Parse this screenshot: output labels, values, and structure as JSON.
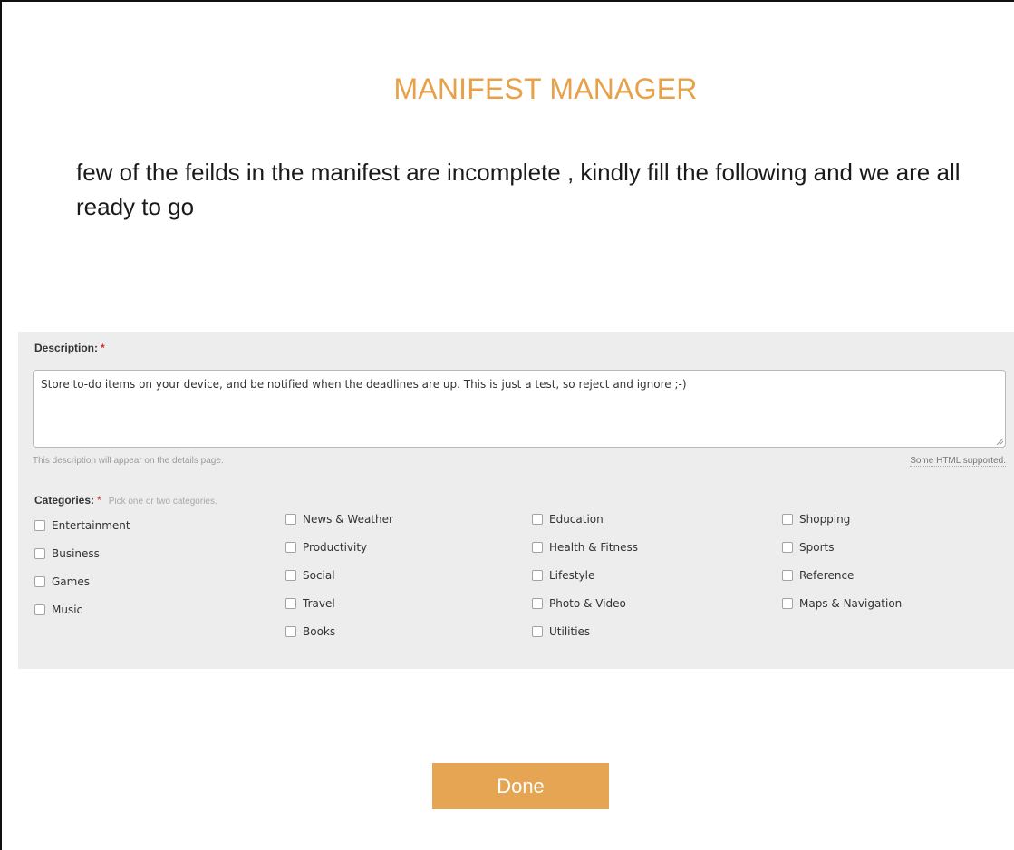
{
  "header": {
    "title": "MANIFEST MANAGER"
  },
  "intro": {
    "text": "few of the feilds in the manifest are incomplete , kindly fill the following and we are all ready to go"
  },
  "description": {
    "label": "Description:",
    "required_mark": "*",
    "value": "Store to-do items on your device, and be notified when the deadlines are up. This is just a test, so reject and ignore ;-)",
    "help_text": "This description will appear on the details page.",
    "html_note": "Some HTML supported."
  },
  "categories": {
    "label": "Categories:",
    "required_mark": "*",
    "hint": "Pick one or two categories.",
    "columns": [
      [
        "Entertainment",
        "Business",
        "Games",
        "Music"
      ],
      [
        "News & Weather",
        "Productivity",
        "Social",
        "Travel",
        "Books"
      ],
      [
        "Education",
        "Health & Fitness",
        "Lifestyle",
        "Photo & Video",
        "Utilities"
      ],
      [
        "Shopping",
        "Sports",
        "Reference",
        "Maps & Navigation"
      ]
    ]
  },
  "actions": {
    "done_label": "Done"
  },
  "colors": {
    "accent": "#e6a552",
    "panel": "#ededed",
    "required": "#d2302c"
  }
}
